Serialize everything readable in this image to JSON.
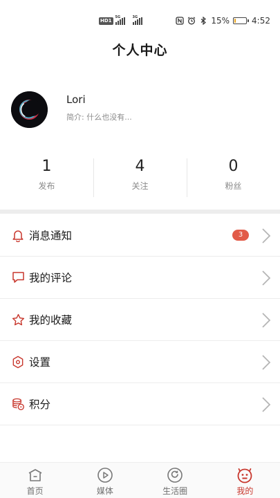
{
  "status_bar": {
    "hd_label": "HD1",
    "sig1_label": "5G",
    "sig2_label": "3G",
    "battery_percent_text": "15%",
    "battery_level": 0.15,
    "time": "4:52"
  },
  "header": {
    "title": "个人中心"
  },
  "profile": {
    "username": "Lori",
    "bio": "简介: 什么也没有..."
  },
  "stats": [
    {
      "value": "1",
      "label": "发布"
    },
    {
      "value": "4",
      "label": "关注"
    },
    {
      "value": "0",
      "label": "粉丝"
    }
  ],
  "menu": {
    "items": [
      {
        "label": "消息通知",
        "icon": "bell-icon",
        "badge": "3"
      },
      {
        "label": "我的评论",
        "icon": "comment-icon"
      },
      {
        "label": "我的收藏",
        "icon": "star-icon"
      },
      {
        "label": "设置",
        "icon": "settings-icon"
      },
      {
        "label": "积分",
        "icon": "coins-icon"
      }
    ]
  },
  "bottom_nav": {
    "items": [
      {
        "label": "首页",
        "icon": "home-icon"
      },
      {
        "label": "媒体",
        "icon": "play-icon"
      },
      {
        "label": "生活圈",
        "icon": "circle-icon"
      },
      {
        "label": "我的",
        "icon": "profile-icon",
        "active": true
      }
    ]
  },
  "colors": {
    "accent": "#c8372d",
    "badge": "#e25b48",
    "battery": "#e8a21a"
  }
}
